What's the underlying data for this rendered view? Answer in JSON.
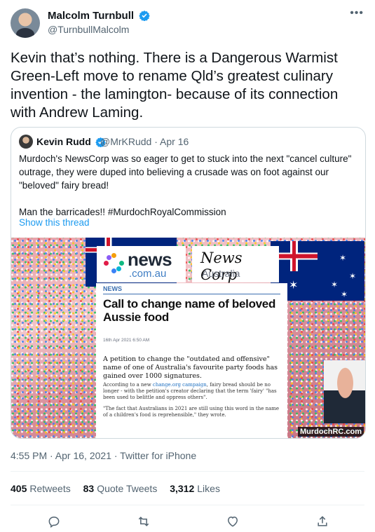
{
  "author": {
    "name": "Malcolm Turnbull",
    "handle": "@TurnbullMalcolm"
  },
  "tweet_text": "Kevin that’s nothing. There is a Dangerous Warmist Green-Left move to rename Qld’s greatest culinary invention - the lamington- because of its connection with Andrew Laming.",
  "quoted": {
    "name": "Kevin Rudd",
    "meta": "@MrKRudd · Apr 16",
    "text_p1": "Murdoch's NewsCorp was so eager to get to stuck into the next \"cancel culture\" outrage, they were duped into believing a crusade was on foot against our \"beloved\" fairy bread!",
    "text_p2": "Man the barricades!!  #MurdochRoyalCommission",
    "show_thread": "Show this thread",
    "image": {
      "news_word": "news",
      "news_sub": ".com.au",
      "corp_word": "News Corp",
      "corp_sub": "Australia",
      "article_tag": "NEWS",
      "article_title": "Call to change name of beloved Aussie food",
      "article_date": "16th Apr 2021 6:50 AM",
      "article_lead": "A petition to change the \"outdated and offensive\" name of one of Australia's favourite party foods has gained over 1000 signatures.",
      "article_body_pre": "According to a new ",
      "article_body_link": "change.org campaign",
      "article_body_post": ", fairy bread should be no longer - with the petition's creator declaring that the term 'fairy' \"has been used to belittle and oppress others\".",
      "article_quote": "\"The fact that Australians in 2021 are still using this word in the name of a children's food is reprehensible,\" they wrote.",
      "watermark": "MurdochRC.com"
    }
  },
  "timestamp": "4:55 PM · Apr 16, 2021 · Twitter for iPhone",
  "stats": {
    "retweets_count": "405",
    "retweets_label": "Retweets",
    "quotes_count": "83",
    "quotes_label": "Quote Tweets",
    "likes_count": "3,312",
    "likes_label": "Likes"
  },
  "colors": {
    "accent": "#1d9bf0",
    "text": "#0f1419",
    "muted": "#536471"
  }
}
